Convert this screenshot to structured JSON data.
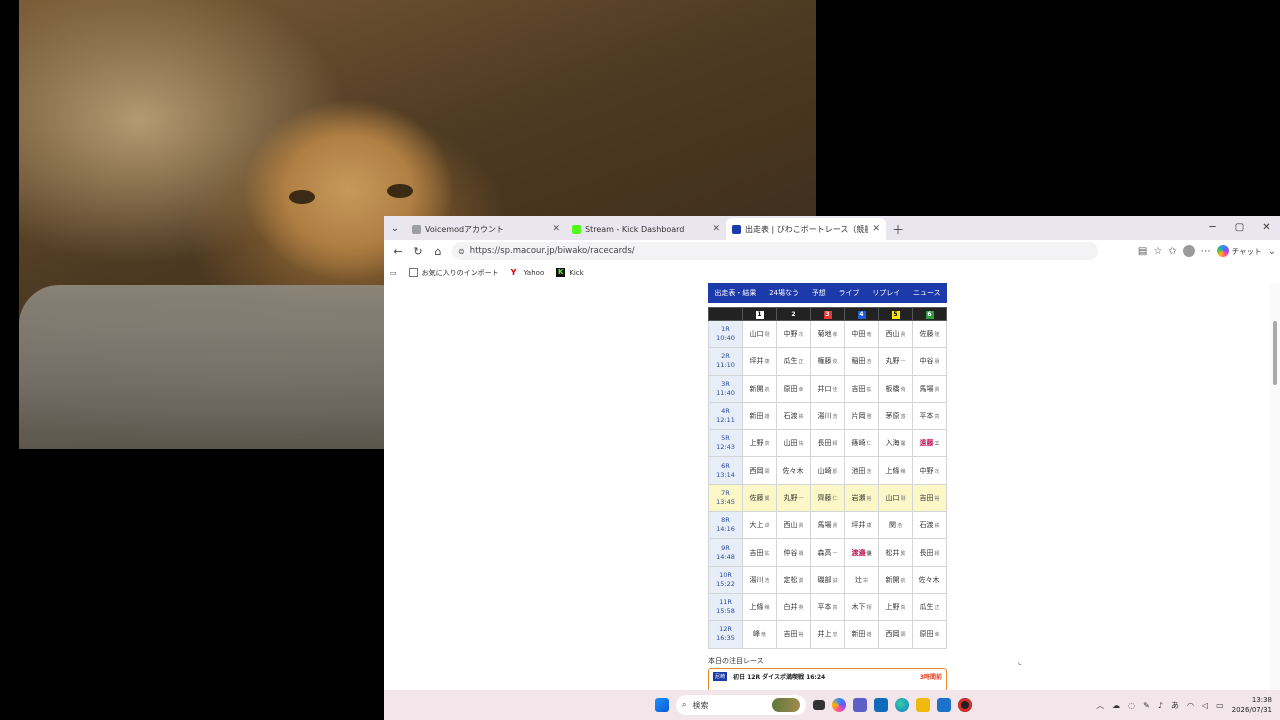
{
  "browser": {
    "tabs": [
      {
        "title": "Voicemodアカウント",
        "active": false,
        "favicon_color": "#9aa0a6"
      },
      {
        "title": "Stream - Kick Dashboard",
        "active": false,
        "favicon_color": "#53fc18"
      },
      {
        "title": "出走表 | びわこボートレース（競艇）I",
        "active": true,
        "favicon_color": "#1c3aa9"
      }
    ],
    "url": "https://sp.macour.jp/biwako/racecards/",
    "copilot_label": "チャット",
    "favorites": [
      {
        "label": "お気に入りのインポート",
        "icon": "import-icon"
      },
      {
        "label": "Yahoo",
        "icon": "yahoo-icon"
      },
      {
        "label": "Kick",
        "icon": "kick-icon"
      }
    ]
  },
  "page": {
    "nav": [
      "出走表・結果",
      "24場なう",
      "予想",
      "ライブ",
      "リプレイ",
      "ニュース"
    ],
    "boats": [
      {
        "num": "1",
        "bg": "#ffffff",
        "fg": "#000000"
      },
      {
        "num": "2",
        "bg": "#222222",
        "fg": "#ffffff"
      },
      {
        "num": "3",
        "bg": "#e53935",
        "fg": "#ffffff"
      },
      {
        "num": "4",
        "bg": "#1e5bd8",
        "fg": "#ffffff"
      },
      {
        "num": "5",
        "bg": "#ffe600",
        "fg": "#000000"
      },
      {
        "num": "6",
        "bg": "#2e9e3e",
        "fg": "#ffffff"
      }
    ],
    "races": [
      {
        "race": "1R",
        "time": "10:40",
        "racers": [
          [
            "山口",
            "剛"
          ],
          [
            "中野",
            "次"
          ],
          [
            "菊地",
            "孝"
          ],
          [
            "中田",
            "竜"
          ],
          [
            "西山",
            "貴"
          ],
          [
            "佐藤",
            "隆"
          ]
        ]
      },
      {
        "race": "2R",
        "time": "11:10",
        "racers": [
          [
            "坪井",
            "康"
          ],
          [
            "瓜生",
            "正"
          ],
          [
            "権藤",
            "俊"
          ],
          [
            "稲田",
            "浩"
          ],
          [
            "丸野",
            "一"
          ],
          [
            "中谷",
            "朋"
          ]
        ]
      },
      {
        "race": "3R",
        "time": "11:40",
        "racers": [
          [
            "新開",
            "航"
          ],
          [
            "原田",
            "幸"
          ],
          [
            "井口",
            "佳"
          ],
          [
            "吉田",
            "拡"
          ],
          [
            "板橋",
            "侑"
          ],
          [
            "馬場",
            "貴"
          ]
        ]
      },
      {
        "race": "4R",
        "time": "12:11",
        "racers": [
          [
            "新田",
            "雄"
          ],
          [
            "石渡",
            "鉄"
          ],
          [
            "湯川",
            "浩"
          ],
          [
            "片岡",
            "雅"
          ],
          [
            "茅原",
            "悠"
          ],
          [
            "平本",
            "真"
          ]
        ]
      },
      {
        "race": "5R",
        "time": "12:43",
        "racers": [
          [
            "上野",
            "真"
          ],
          [
            "山田",
            "祐"
          ],
          [
            "長田",
            "頼"
          ],
          [
            "篠崎",
            "仁"
          ],
          [
            "入海",
            "馨"
          ],
          [
            "遠藤",
            "エ"
          ]
        ]
      },
      {
        "race": "6R",
        "time": "13:14",
        "racers": [
          [
            "西岡",
            "顕"
          ],
          [
            "佐々木",
            ""
          ],
          [
            "山崎",
            "郡"
          ],
          [
            "池田",
            "浩"
          ],
          [
            "上條",
            "暢"
          ],
          [
            "中野",
            "次"
          ]
        ]
      },
      {
        "race": "7R",
        "time": "13:45",
        "racers": [
          [
            "佐藤",
            "翼"
          ],
          [
            "丸野",
            "一"
          ],
          [
            "齊藤",
            "仁"
          ],
          [
            "岩瀬",
            "裕"
          ],
          [
            "山口",
            "剛"
          ],
          [
            "吉田",
            "裕"
          ]
        ]
      },
      {
        "race": "8R",
        "time": "14:16",
        "racers": [
          [
            "大上",
            "卓"
          ],
          [
            "西山",
            "貴"
          ],
          [
            "馬場",
            "貴"
          ],
          [
            "坪井",
            "康"
          ],
          [
            "関",
            "浩"
          ],
          [
            "石渡",
            "鉄"
          ]
        ]
      },
      {
        "race": "9R",
        "time": "14:48",
        "racers": [
          [
            "吉田",
            "拡"
          ],
          [
            "仲谷",
            "颯"
          ],
          [
            "森高",
            "一"
          ],
          [
            "渡邉",
            "優"
          ],
          [
            "松井",
            "繁"
          ],
          [
            "長田",
            "頼"
          ]
        ]
      },
      {
        "race": "10R",
        "time": "15:22",
        "racers": [
          [
            "湯川",
            "浩"
          ],
          [
            "定松",
            "勇"
          ],
          [
            "磯部",
            "誠"
          ],
          [
            "辻",
            "栄"
          ],
          [
            "新開",
            "航"
          ],
          [
            "佐々木",
            ""
          ]
        ]
      },
      {
        "race": "11R",
        "time": "15:58",
        "racers": [
          [
            "上條",
            "暢"
          ],
          [
            "白井",
            "英"
          ],
          [
            "平本",
            "真"
          ],
          [
            "木下",
            "翔"
          ],
          [
            "上野",
            "真"
          ],
          [
            "瓜生",
            "正"
          ]
        ]
      },
      {
        "race": "12R",
        "time": "16:35",
        "racers": [
          [
            "峰",
            "竜"
          ],
          [
            "吉田",
            "裕"
          ],
          [
            "井上",
            "忠"
          ],
          [
            "新田",
            "雄"
          ],
          [
            "西岡",
            "顕"
          ],
          [
            "原田",
            "幸"
          ]
        ]
      }
    ],
    "highlight_race": "7R",
    "red_names": [
      "遠藤",
      "渡邉"
    ],
    "attention_label": "本日の注目レース",
    "feature": {
      "tag": "尼崎",
      "title": "初日 12R ダイスポ満喫戦 16:24",
      "time": "3時間前"
    }
  },
  "taskbar": {
    "search_placeholder": "検索",
    "ime": "あ",
    "time": "13:38",
    "date": "2026/07/31"
  }
}
